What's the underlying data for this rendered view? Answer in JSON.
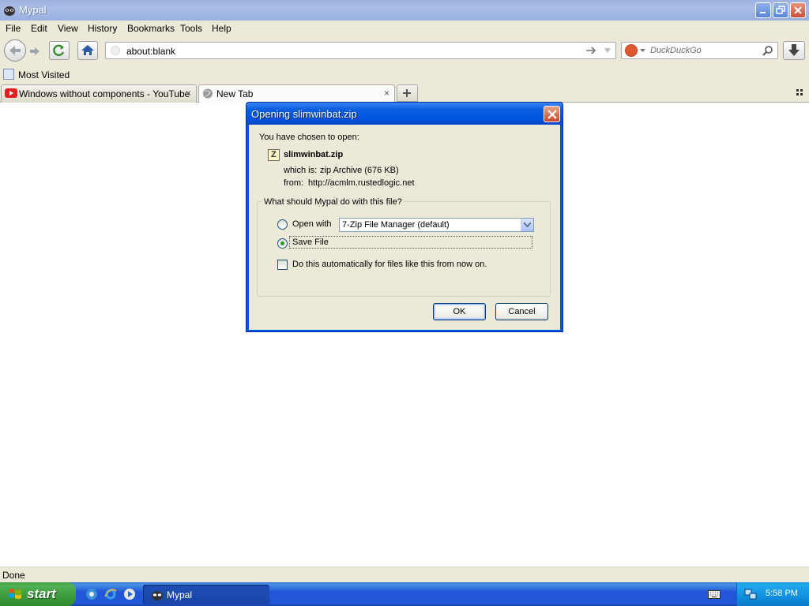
{
  "window": {
    "title": "Mypal"
  },
  "menu": [
    "File",
    "Edit",
    "View",
    "History",
    "Bookmarks",
    "Tools",
    "Help"
  ],
  "navbar": {
    "url": "about:blank",
    "search_placeholder": "DuckDuckGo"
  },
  "bookmarks": {
    "most_visited": "Most Visited"
  },
  "tabs": [
    {
      "label": "Windows without components - YouTube",
      "close": "×"
    },
    {
      "label": "New Tab",
      "close": "×"
    }
  ],
  "status": {
    "text": "Done"
  },
  "dialog": {
    "title": "Opening slimwinbat.zip",
    "chosen_label": "You have chosen to open:",
    "filename": "slimwinbat.zip",
    "which_is_label": "which is:",
    "which_is_value": "zip Archive (676 KB)",
    "from_label": "from:",
    "from_value": "http://acmlm.rustedlogic.net",
    "question": "What should Mypal do with this file?",
    "open_with_label": "Open with",
    "open_with_app": "7-Zip File Manager (default)",
    "save_file_label": "Save File",
    "selected_option": "Save File",
    "auto_label": "Do this automatically for files like this from now on.",
    "auto_checked": false,
    "ok_label": "OK",
    "cancel_label": "Cancel"
  },
  "taskbar": {
    "start_label": "start",
    "task_label": "Mypal",
    "clock": "5:58 PM"
  },
  "colors": {
    "xp_blue": "#0054e3",
    "start_green": "#3a9a3a",
    "face": "#ece9d8"
  }
}
